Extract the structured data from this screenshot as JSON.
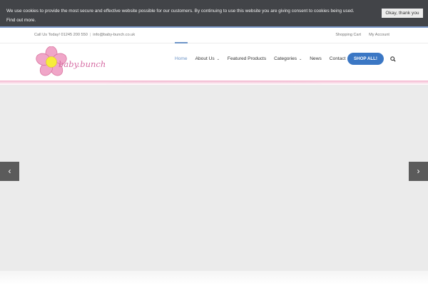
{
  "cookie": {
    "message": "We use cookies to provide the most secure and effective website possible for our customers. By continuing to use this website you are giving consent to cookies being used.",
    "find_out_more": "Find out more.",
    "accept_label": "Okay, thank you"
  },
  "topbar": {
    "call_text": "Call Us Today! 01245 200 550",
    "separator": "|",
    "email": "info@baby-bunch.co.uk",
    "links": [
      "Shopping Cart",
      "My Account"
    ]
  },
  "logo": {
    "text": "baby.bunch"
  },
  "nav": {
    "items": [
      {
        "label": "Home",
        "active": true
      },
      {
        "label": "About Us",
        "dropdown": true
      },
      {
        "label": "Featured Products"
      },
      {
        "label": "Categories",
        "dropdown": true
      },
      {
        "label": "News"
      },
      {
        "label": "Contact"
      }
    ],
    "shop_label": "SHOP ALL!",
    "chevron": "⌄"
  },
  "slider": {
    "prev": "‹",
    "next": "›"
  },
  "colors": {
    "accent": "#6d94c7",
    "shop_button": "#3b77c4",
    "brand_pink": "#f0a6c8"
  }
}
